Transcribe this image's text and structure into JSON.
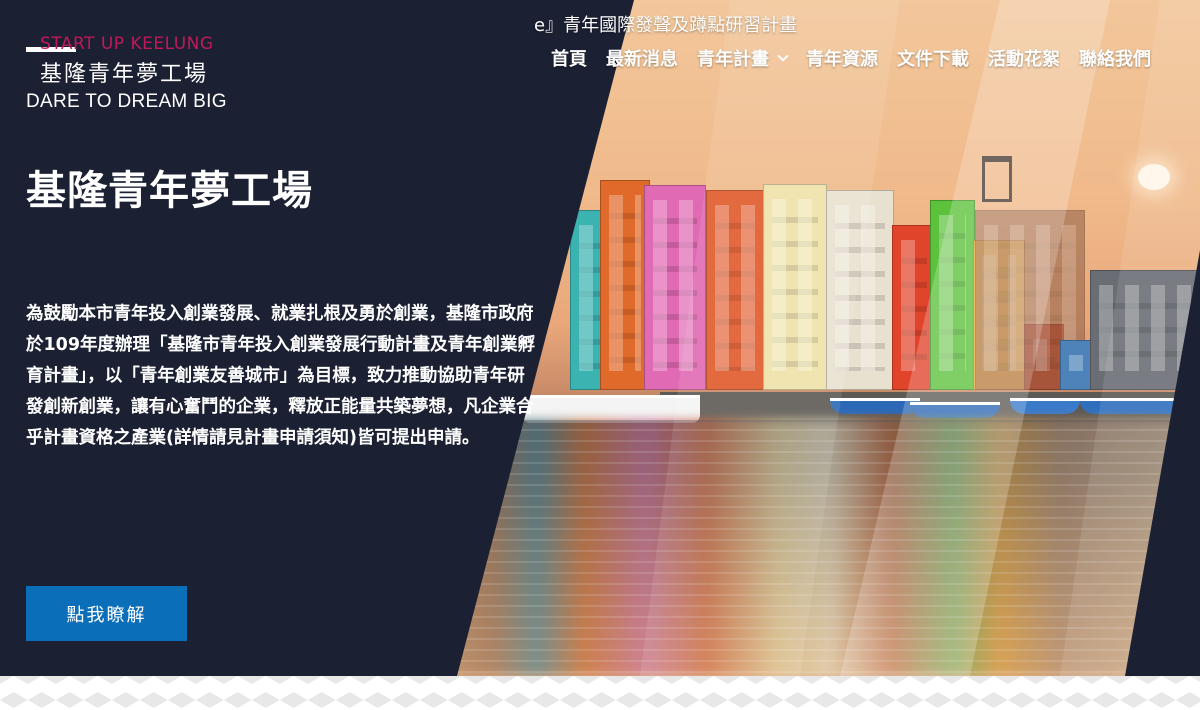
{
  "logo": {
    "en": "START UP KEELUNG",
    "zh": "基隆青年夢工場",
    "tagline": "DARE TO DREAM BIG"
  },
  "ticker": "e』青年國際發聲及蹲點研習計畫",
  "nav": {
    "items": [
      {
        "label": "首頁"
      },
      {
        "label": "最新消息"
      },
      {
        "label": "青年計畫",
        "has_dropdown": true
      },
      {
        "label": "青年資源"
      },
      {
        "label": "文件下載"
      },
      {
        "label": "活動花絮"
      },
      {
        "label": "聯絡我們"
      }
    ]
  },
  "hero": {
    "title": "基隆青年夢工場",
    "description": "為鼓勵本市青年投入創業發展、就業扎根及勇於創業，基隆市政府於109年度辦理「基隆市青年投入創業發展行動計畫及青年創業孵育計畫」，以「青年創業友善城市」為目標，致力推動協助青年研發創新創業，讓有心奮鬥的企業，釋放正能量共築夢想，凡企業合乎計畫資格之產業(詳情請見計畫申請須知)皆可提出申請。",
    "cta_label": "點我瞭解"
  },
  "colors": {
    "panel": "#1b2133",
    "accent_pink": "#c2185b",
    "cta_blue": "#0a6fb8"
  }
}
